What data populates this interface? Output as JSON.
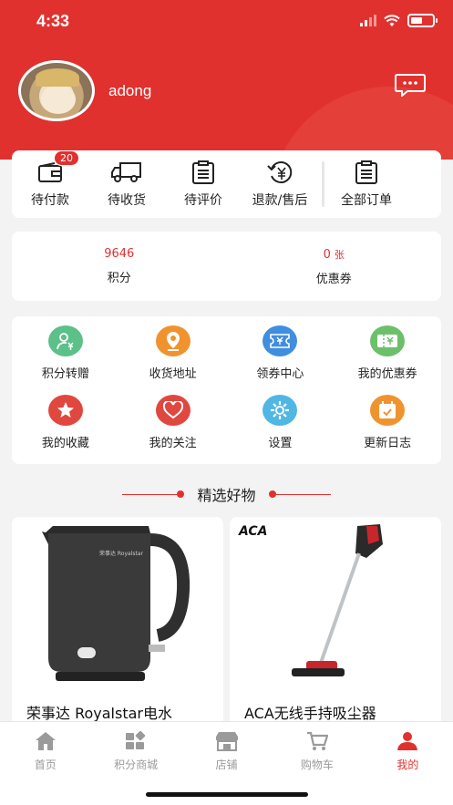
{
  "status": {
    "time": "4:33"
  },
  "profile": {
    "username": "adong"
  },
  "orders": [
    {
      "label": "待付款",
      "badge": "20",
      "icon": "wallet-icon"
    },
    {
      "label": "待收货",
      "icon": "truck-icon"
    },
    {
      "label": "待评价",
      "icon": "clipboard-icon"
    },
    {
      "label": "退款/售后",
      "icon": "refund-icon"
    },
    {
      "label": "全部订单",
      "icon": "order-list-icon"
    }
  ],
  "stats": {
    "points_value": "9646",
    "points_label": "积分",
    "coupons_value": "0",
    "coupons_unit": "张",
    "coupons_label": "优惠券"
  },
  "services": [
    {
      "label": "积分转赠",
      "icon": "user-transfer-icon",
      "color": "#5cc089"
    },
    {
      "label": "收货地址",
      "icon": "location-icon",
      "color": "#f0932f"
    },
    {
      "label": "领券中心",
      "icon": "coupon-icon",
      "color": "#3f8ee0"
    },
    {
      "label": "我的优惠券",
      "icon": "ticket-icon",
      "color": "#6cc06a"
    },
    {
      "label": "我的收藏",
      "icon": "star-icon",
      "color": "#e0473f"
    },
    {
      "label": "我的关注",
      "icon": "heart-icon",
      "color": "#e0473f"
    },
    {
      "label": "设置",
      "icon": "gear-icon",
      "color": "#4fb7e3"
    },
    {
      "label": "更新日志",
      "icon": "calendar-icon",
      "color": "#f0932f"
    }
  ],
  "section_title": "精选好物",
  "products": [
    {
      "name": "荣事达 Royalstar电水",
      "brand": "荣事达 Royalstar"
    },
    {
      "name": "ACA无线手持吸尘器",
      "brand": "ACA"
    }
  ],
  "tabs": [
    {
      "label": "首页",
      "icon": "home-icon"
    },
    {
      "label": "积分商城",
      "icon": "points-mall-icon"
    },
    {
      "label": "店铺",
      "icon": "store-icon"
    },
    {
      "label": "购物车",
      "icon": "cart-icon"
    },
    {
      "label": "我的",
      "icon": "user-icon",
      "active": true
    }
  ],
  "colors": {
    "accent": "#e0312f"
  }
}
